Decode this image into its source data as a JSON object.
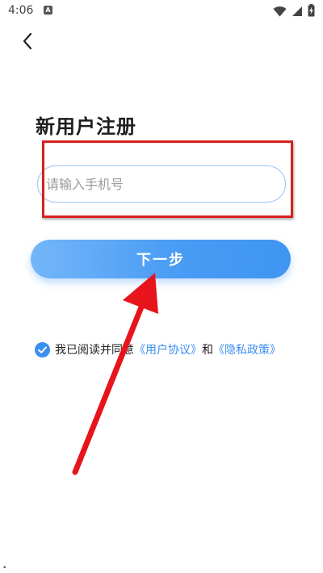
{
  "status_bar": {
    "time": "4:06",
    "notification_icon": "a-badge-icon",
    "icons": [
      "wifi-icon",
      "signal-icon",
      "battery-charging-icon"
    ]
  },
  "nav": {
    "back_icon": "chevron-left-icon"
  },
  "page": {
    "title": "新用户注册"
  },
  "phone_input": {
    "placeholder": "请输入手机号",
    "value": ""
  },
  "next_button": {
    "label": "下一步"
  },
  "agreement": {
    "checked": true,
    "prefix": "我已阅读并同意",
    "user_agreement_link": "《用户协议》",
    "conjunction": "和",
    "privacy_policy_link": "《隐私政策》"
  },
  "annotations": {
    "highlight_color": "#d8201e",
    "arrow_color": "#e8141c"
  },
  "colors": {
    "accent": "#3b8ff0",
    "button_gradient_start": "#74b6f9",
    "button_gradient_end": "#3f95f2"
  }
}
